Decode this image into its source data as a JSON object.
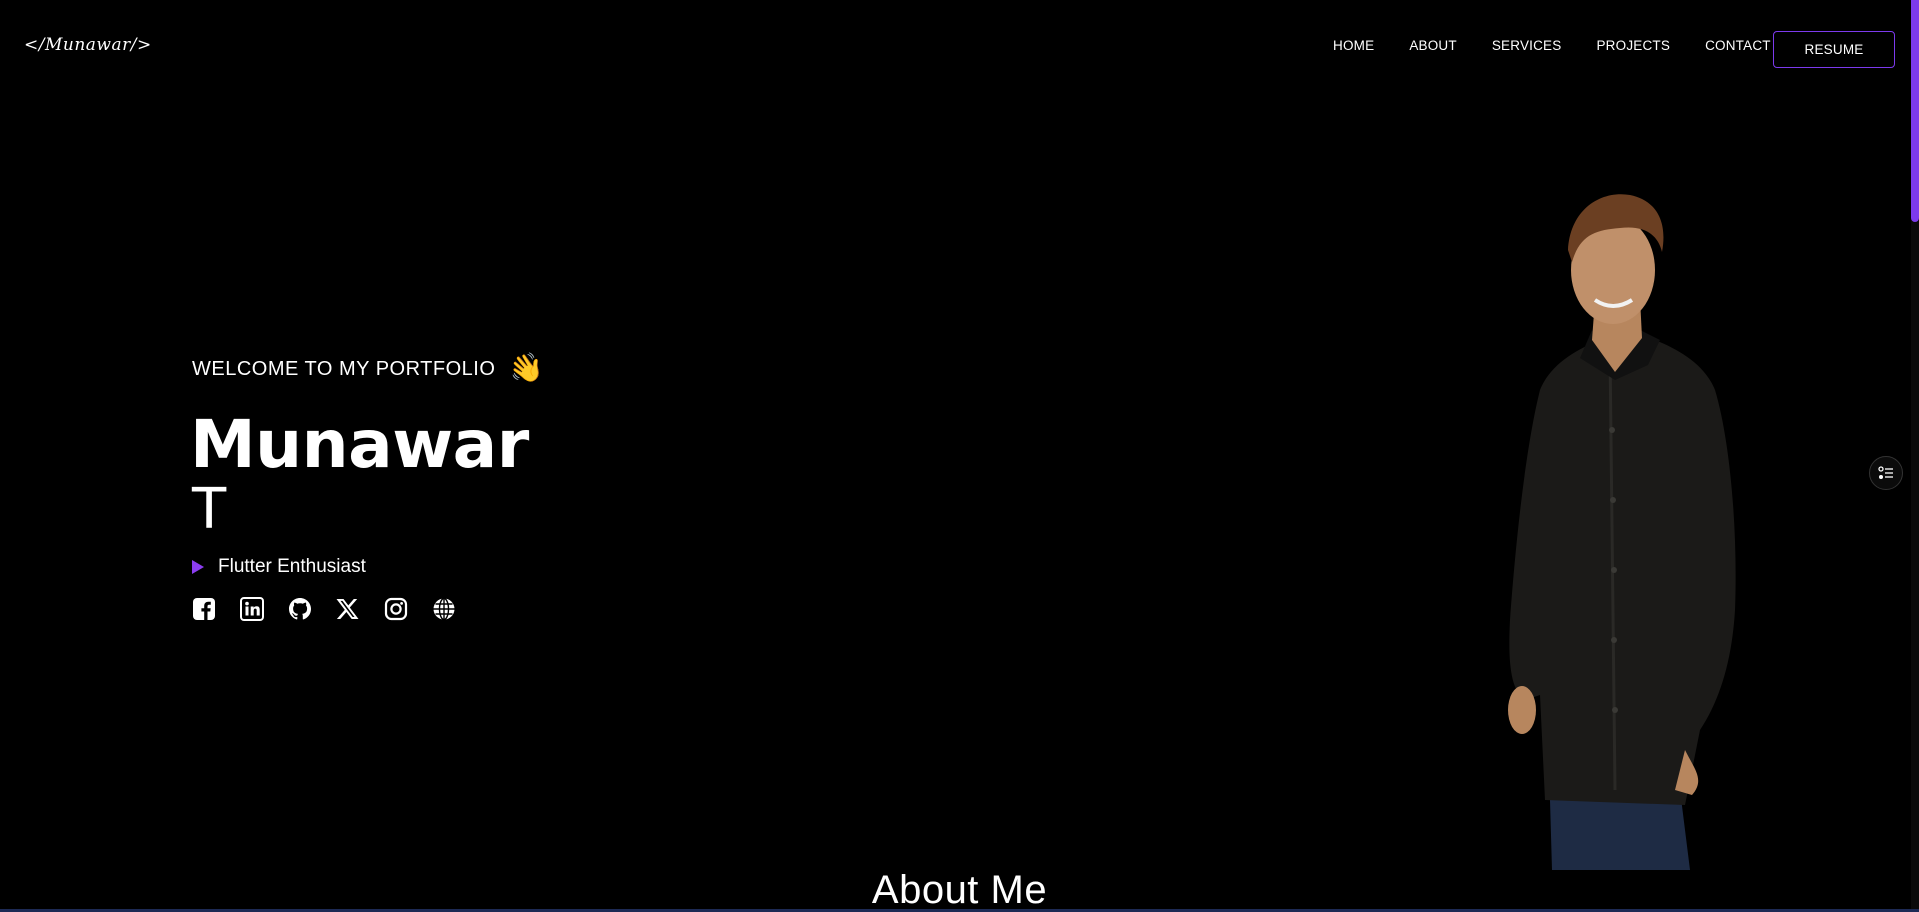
{
  "header": {
    "logo_text": "</Munawar/>",
    "nav": [
      "HOME",
      "ABOUT",
      "SERVICES",
      "PROJECTS",
      "CONTACT"
    ],
    "resume_label": "RESUME"
  },
  "hero": {
    "welcome": "WELCOME TO MY PORTFOLIO",
    "wave_emoji": "👋",
    "name_first": "Munawar",
    "name_last": "T",
    "role": "Flutter Enthusiast",
    "socials": [
      "facebook-icon",
      "linkedin-icon",
      "github-icon",
      "x-icon",
      "instagram-icon",
      "globe-icon"
    ]
  },
  "about": {
    "title": "About Me"
  },
  "colors": {
    "accent": "#7c3aed",
    "background": "#000000",
    "text": "#ffffff"
  }
}
